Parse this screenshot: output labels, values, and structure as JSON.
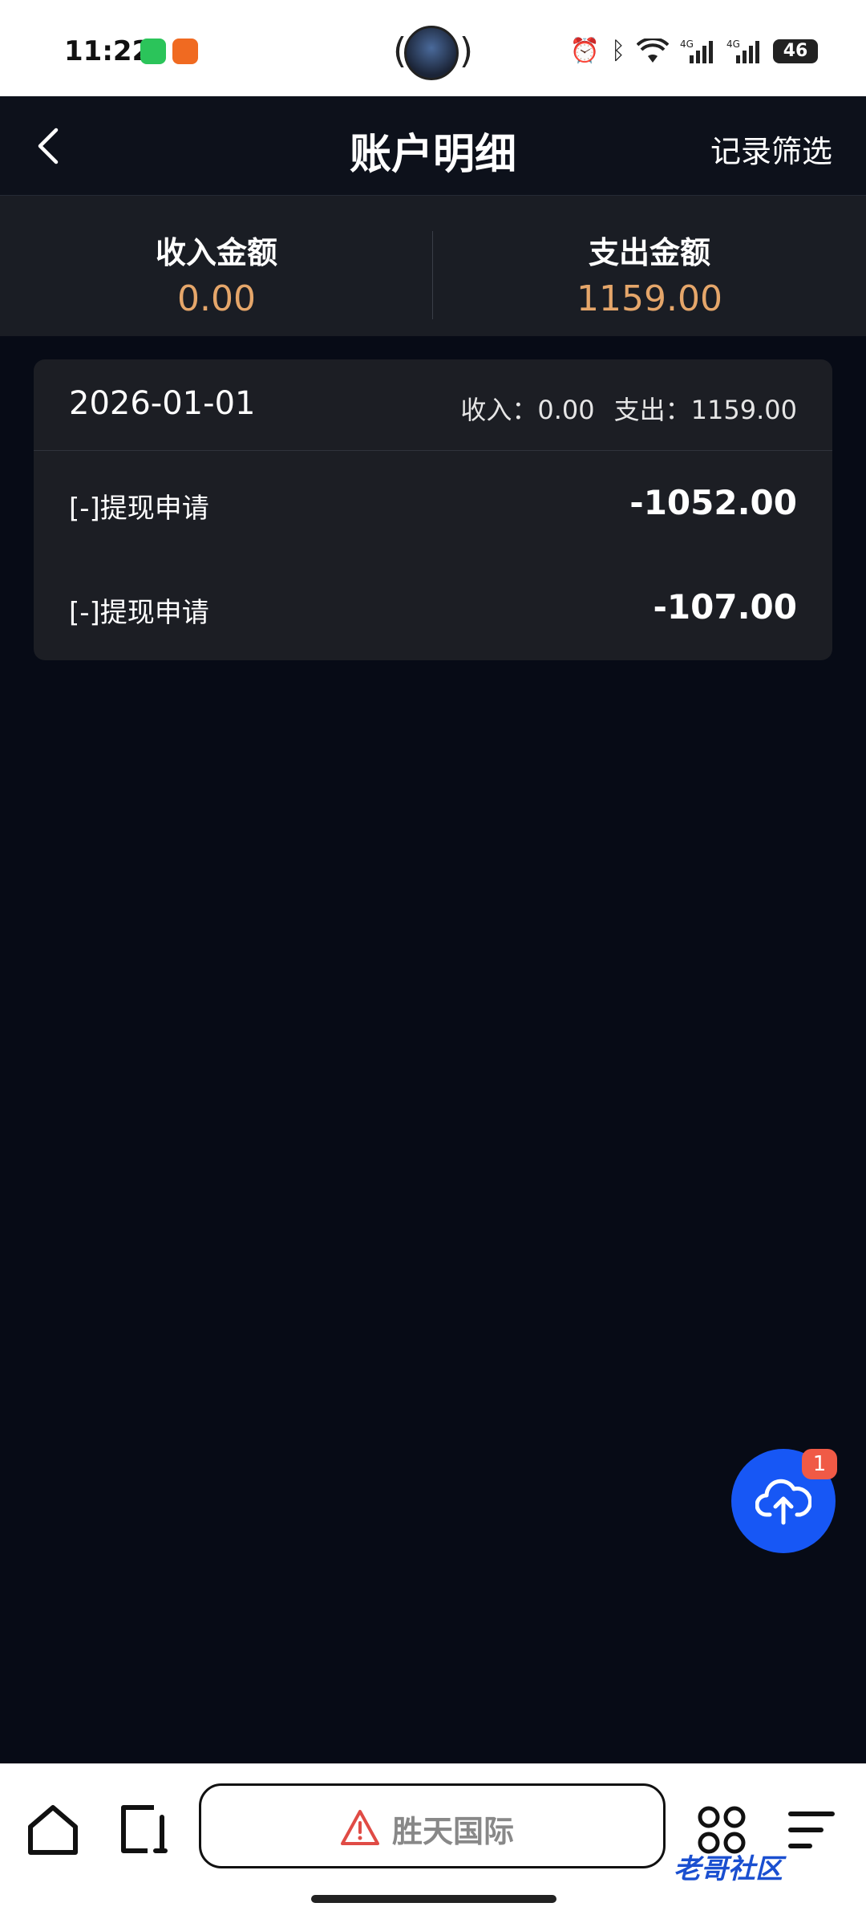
{
  "status_bar": {
    "time": "11:22",
    "icons": [
      "wechat-icon",
      "app-icon",
      "alarm-icon",
      "bluetooth-icon",
      "wifi-icon",
      "signal-4g-icon",
      "signal-4g-icon"
    ],
    "battery": "46"
  },
  "navbar": {
    "title": "账户明细",
    "action": "记录筛选"
  },
  "summary": {
    "income_label": "收入金额",
    "income_value": "0.00",
    "expense_label": "支出金额",
    "expense_value": "1159.00"
  },
  "day_group": {
    "date": "2026-01-01",
    "income_text": "收入：0.00",
    "expense_text": "支出：1159.00",
    "rows": [
      {
        "desc": "[-]提现申请",
        "amount": "-1052.00"
      },
      {
        "desc": "[-]提现申请",
        "amount": "-107.00"
      }
    ]
  },
  "fab": {
    "badge": "1"
  },
  "browser": {
    "site_name": "胜天国际"
  },
  "watermark": "老哥社区",
  "colors": {
    "accent_amount": "#e5a66a",
    "fab_blue": "#1757f5",
    "badge_red": "#f05a46"
  }
}
